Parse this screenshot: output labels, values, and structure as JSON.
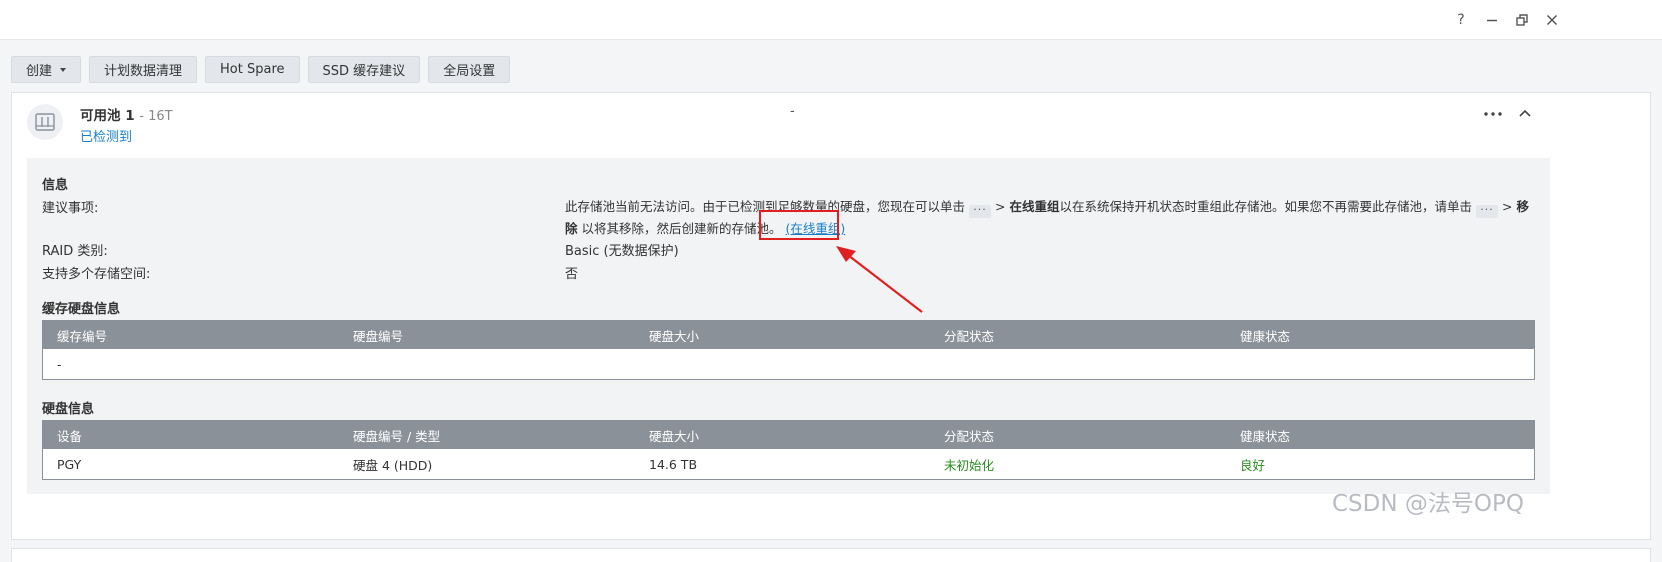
{
  "window_controls": {
    "help": "?",
    "minimize": "minimize",
    "restore": "restore",
    "close": "close"
  },
  "toolbar": {
    "create_label": "创建",
    "schedule_cleanup_label": "计划数据清理",
    "hot_spare_label": "Hot Spare",
    "ssd_cache_advice_label": "SSD 缓存建议",
    "global_settings_label": "全局设置"
  },
  "pool": {
    "name": "可用池 1",
    "size": "- 16T",
    "status": "已检测到",
    "mid_value": "-"
  },
  "info": {
    "section_title": "信息",
    "advice_label": "建议事项:",
    "advice_part1": "此存储池当前无法访问。由于已检测到足够数量的硬盘，您现在可以单击",
    "advice_dots": "···",
    "advice_gt1": ">",
    "advice_bold1": "在线重组",
    "advice_part2": "以在系统保持开机状态时重组此存储池。如果您不再需要此存储池，请单击",
    "advice_gt2": ">",
    "advice_bold2": "移除",
    "advice_part3": "以将其移除，然后创建新的存储池。",
    "advice_link": "(在线重组)",
    "raid_label": "RAID 类别:",
    "raid_value": "Basic (无数据保护)",
    "multi_space_label": "支持多个存储空间:",
    "multi_space_value": "否"
  },
  "cache_table": {
    "section_title": "缓存硬盘信息",
    "headers": [
      "缓存编号",
      "硬盘编号",
      "硬盘大小",
      "分配状态",
      "健康状态"
    ],
    "rows": [
      [
        "-",
        "",
        "",
        "",
        ""
      ]
    ]
  },
  "disk_table": {
    "section_title": "硬盘信息",
    "headers": [
      "设备",
      "硬盘编号 / 类型",
      "硬盘大小",
      "分配状态",
      "健康状态"
    ],
    "rows": [
      [
        "PGY",
        "硬盘 4 (HDD)",
        "14.6 TB",
        "未初始化",
        "良好"
      ]
    ]
  },
  "colors": {
    "accent": "#1a7ec7",
    "status_green": "#2a8a1f",
    "highlight_red": "#e02020",
    "table_header": "#8b9199"
  },
  "watermark": "CSDN @法号OPQ"
}
